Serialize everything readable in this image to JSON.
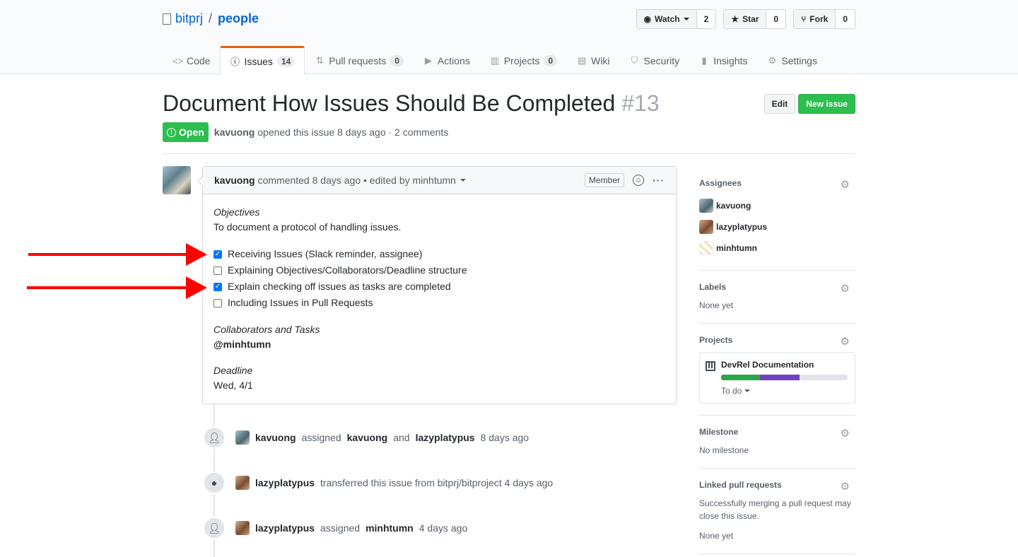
{
  "repo": {
    "owner": "bitprj",
    "separator": "/",
    "name": "people"
  },
  "actions": [
    {
      "label": "Watch",
      "icon": "eye-icon",
      "count": "2"
    },
    {
      "label": "Star",
      "icon": "star-icon",
      "count": "0"
    },
    {
      "label": "Fork",
      "icon": "fork-icon",
      "count": "0"
    }
  ],
  "nav": [
    {
      "label": "Code",
      "icon": "code-icon"
    },
    {
      "label": "Issues",
      "icon": "issue-icon",
      "counter": "14",
      "selected": true
    },
    {
      "label": "Pull requests",
      "icon": "pull-request-icon",
      "counter": "0"
    },
    {
      "label": "Actions",
      "icon": "play-icon"
    },
    {
      "label": "Projects",
      "icon": "project-icon",
      "counter": "0"
    },
    {
      "label": "Wiki",
      "icon": "book-icon"
    },
    {
      "label": "Security",
      "icon": "shield-icon"
    },
    {
      "label": "Insights",
      "icon": "graph-icon"
    },
    {
      "label": "Settings",
      "icon": "gear-icon"
    }
  ],
  "issue": {
    "title": "Document How Issues Should Be Completed",
    "number": "#13",
    "state": "Open",
    "author": "kavuong",
    "opened_text": "opened this issue 8 days ago · 2 comments",
    "edit_label": "Edit",
    "new_issue_label": "New issue"
  },
  "comment": {
    "author": "kavuong",
    "meta": "commented 8 days ago • edited by minhtumn",
    "role": "Member",
    "objectives_heading": "Objectives",
    "objectives_text": "To document a protocol of handling issues.",
    "tasks": [
      {
        "label": "Receiving Issues (Slack reminder, assignee)",
        "checked": true
      },
      {
        "label": "Explaining Objectives/Collaborators/Deadline structure",
        "checked": false
      },
      {
        "label": "Explain checking off issues as tasks are completed",
        "checked": true
      },
      {
        "label": "Including Issues in Pull Requests",
        "checked": false
      }
    ],
    "collab_heading": "Collaborators and Tasks",
    "collab_text": "@minhtumn",
    "deadline_heading": "Deadline",
    "deadline_text": "Wed, 4/1"
  },
  "timeline": [
    {
      "actor": "kavuong",
      "parts": [
        "assigned",
        "kavuong",
        "and",
        "lazyplatypus",
        "8 days ago"
      ]
    },
    {
      "actor": "lazyplatypus",
      "parts": [
        "transferred this issue from bitprj/bitproject 4 days ago"
      ]
    },
    {
      "actor": "lazyplatypus",
      "parts": [
        "assigned",
        "minhtumn",
        "4 days ago"
      ]
    }
  ],
  "sidebar": {
    "assignees_heading": "Assignees",
    "assignees": [
      "kavuong",
      "lazyplatypus",
      "minhtumn"
    ],
    "labels_heading": "Labels",
    "labels_text": "None yet",
    "projects_heading": "Projects",
    "project_name": "DevRel Documentation",
    "project_column": "To do",
    "project_progress": {
      "done": 0.31,
      "in_progress": 0.31
    },
    "milestone_heading": "Milestone",
    "milestone_text": "No milestone",
    "linked_heading": "Linked pull requests",
    "linked_text": "Successfully merging a pull request may close this issue.",
    "linked_none": "None yet"
  },
  "colors": {
    "accent": "#0366d6",
    "open": "#2cbe4e",
    "arrow": "#ff0000",
    "tab_highlight": "#e36209"
  }
}
